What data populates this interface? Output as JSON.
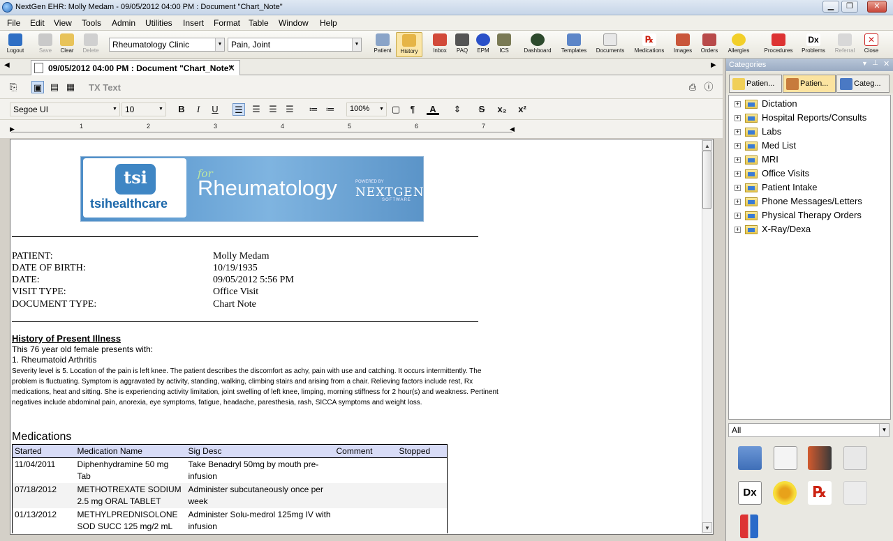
{
  "window": {
    "title": "NextGen EHR: Molly Medam - 09/05/2012 04:00 PM  : Document \"Chart_Note\"",
    "minimize": "▁",
    "restore": "❐",
    "close": "✕"
  },
  "menu": [
    "File",
    "Edit",
    "View",
    "Tools",
    "Admin",
    "Utilities",
    "Insert",
    "Format",
    "Table",
    "Window",
    "Help"
  ],
  "toolbar": {
    "left": [
      {
        "label": "Logout",
        "icon": "logout-icon",
        "enabled": true
      },
      {
        "label": "Save",
        "icon": "save-icon",
        "enabled": false
      },
      {
        "label": "Clear",
        "icon": "eraser-icon",
        "enabled": true
      },
      {
        "label": "Delete",
        "icon": "delete-icon",
        "enabled": false
      }
    ],
    "practice_combo": "Rheumatology Clinic",
    "reason_combo": "Pain, Joint",
    "right": [
      {
        "label": "Patient",
        "icon": "patient-icon"
      },
      {
        "label": "History",
        "icon": "history-icon",
        "selected": true
      },
      {
        "label": "Inbox",
        "icon": "inbox-icon"
      },
      {
        "label": "PAQ",
        "icon": "paq-icon"
      },
      {
        "label": "EPM",
        "icon": "epm-icon"
      },
      {
        "label": "ICS",
        "icon": "ics-icon"
      },
      {
        "label": "Dashboard",
        "icon": "dashboard-icon"
      },
      {
        "label": "Templates",
        "icon": "templates-icon"
      },
      {
        "label": "Documents",
        "icon": "documents-icon"
      },
      {
        "label": "Medications",
        "icon": "rx-icon"
      },
      {
        "label": "Images",
        "icon": "images-icon"
      },
      {
        "label": "Orders",
        "icon": "orders-icon"
      },
      {
        "label": "Allergies",
        "icon": "allergies-icon"
      },
      {
        "label": "Procedures",
        "icon": "procedures-icon"
      },
      {
        "label": "Problems",
        "icon": "dx-icon"
      },
      {
        "label": "Referral",
        "icon": "referral-icon",
        "enabled": false
      },
      {
        "label": "Close",
        "icon": "close-doc-icon"
      }
    ]
  },
  "doc_tab": {
    "label": "09/05/2012 04:00 PM  : Document \"Chart_Note\"",
    "close": "✕"
  },
  "editor": {
    "tx_label": "TX Text",
    "font": "Segoe UI",
    "size": "10",
    "zoom": "100%",
    "ruler": [
      "1",
      "2",
      "3",
      "4",
      "5",
      "6",
      "7"
    ]
  },
  "logo": {
    "company": "tsihealthcare",
    "mark": "tsi",
    "for": "for",
    "product": "Rheumatology",
    "powered": "POWERED BY",
    "brand": "NEXTGEN",
    "software": "SOFTWARE"
  },
  "patient_info": [
    {
      "label": "PATIENT:",
      "value": "Molly  Medam"
    },
    {
      "label": "DATE OF BIRTH:",
      "value": "10/19/1935"
    },
    {
      "label": "DATE:",
      "value": "09/05/2012 5:56 PM"
    },
    {
      "label": "VISIT TYPE:",
      "value": "Office Visit"
    },
    {
      "label": "DOCUMENT TYPE:",
      "value": "Chart Note"
    }
  ],
  "hpi": {
    "title": "History of Present Illness",
    "intro": "This 76 year old female presents with:",
    "item": "1.  Rheumatoid Arthritis",
    "detail": "  Severity level is 5.  Location of the pain is left knee.  The patient describes the discomfort as achy, pain with use and catching.  It occurs intermittently.  The problem is fluctuating.  Symptom is aggravated by activity, standing, walking, climbing stairs and arising from a chair.  Relieving factors include rest, Rx medications, heat and sitting.  She is experiencing activity limitation, joint swelling of left knee, limping, morning stiffness for 2 hour(s) and weakness.  Pertinent negatives include abdominal pain, anorexia, eye symptoms, fatigue, headache, paresthesia, rash, SICCA symptoms and weight loss."
  },
  "medications": {
    "title": "Medications",
    "columns": [
      "Started",
      "Medication Name",
      "Sig Desc",
      "Comment",
      "Stopped"
    ],
    "rows": [
      [
        "11/04/2011",
        "Diphenhydramine 50 mg Tab",
        "Take Benadryl 50mg by mouth pre-infusion",
        "",
        ""
      ],
      [
        "07/18/2012",
        "METHOTREXATE SODIUM 2.5 mg ORAL TABLET",
        "Administer subcutaneously once per week",
        "",
        ""
      ],
      [
        "01/13/2012",
        "METHYLPREDNISOLONE SOD SUCC 125 mg/2 mL",
        "Administer Solu-medrol 125mg IV with infusion",
        "",
        ""
      ]
    ]
  },
  "categories": {
    "title": "Categories",
    "tabs": [
      "Patien...",
      "Patien...",
      "Categ..."
    ],
    "tree": [
      "Dictation",
      "Hospital Reports/Consults",
      "Labs",
      "Med List",
      "MRI",
      "Office Visits",
      "Patient Intake",
      "Phone Messages/Letters",
      "Physical Therapy Orders",
      "X-Ray/Dexa"
    ],
    "filter": "All"
  }
}
